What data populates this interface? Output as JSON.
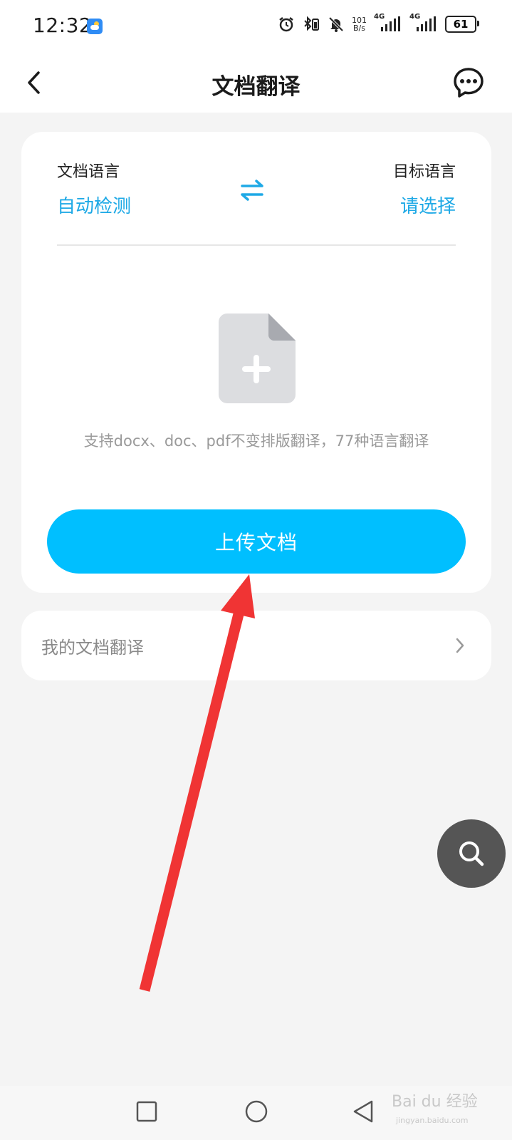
{
  "status_bar": {
    "time": "12:32",
    "net_speed_value": "101",
    "net_speed_unit": "B/s",
    "signal1_label": "4G",
    "signal2_label": "4G",
    "battery": "61"
  },
  "nav": {
    "title": "文档翻译"
  },
  "card": {
    "source_label": "文档语言",
    "source_value": "自动检测",
    "target_label": "目标语言",
    "target_value": "请选择",
    "hint": "支持docx、doc、pdf不变排版翻译，77种语言翻译",
    "upload_button": "上传文档"
  },
  "my_docs": {
    "label": "我的文档翻译"
  },
  "watermark": {
    "brand": "Bai du 经验",
    "sub": "jingyan.baidu.com"
  },
  "colors": {
    "accent": "#00bfff",
    "link_blue": "#1ea9e6",
    "arrow_red": "#f03434"
  }
}
